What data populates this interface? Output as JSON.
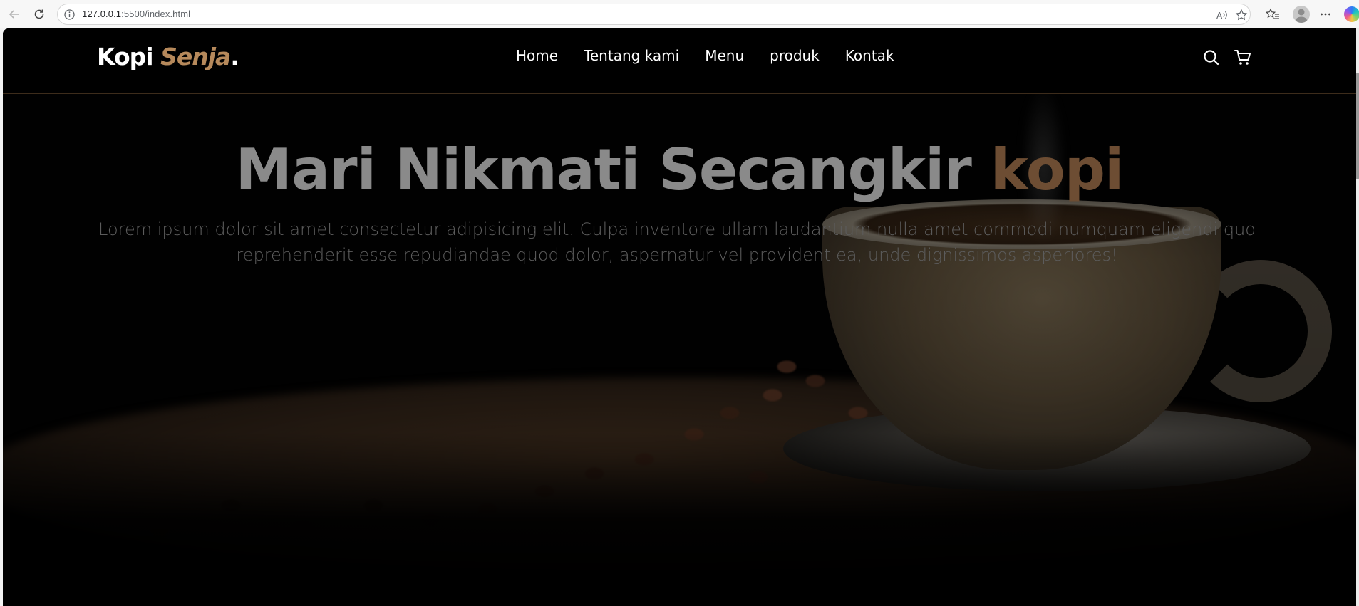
{
  "browser": {
    "url_host": "127.0.0.1",
    "url_path": ":5500/index.html",
    "icons": [
      "back-icon",
      "reload-icon",
      "info-icon",
      "read-aloud-icon",
      "favorite-star-icon",
      "favorites-list-icon",
      "profile-icon",
      "more-icon",
      "copilot-icon"
    ]
  },
  "navbar": {
    "logo_main": "Kopi ",
    "logo_accent": "Senja",
    "logo_dot": ".",
    "links": [
      "Home",
      "Tentang kami",
      "Menu",
      "produk",
      "Kontak"
    ],
    "icons": [
      "search-icon",
      "cart-icon"
    ]
  },
  "hero": {
    "title_main": "Mari Nikmati Secangkir ",
    "title_accent": "kopi",
    "description": "Lorem ipsum dolor sit amet consectetur adipisicing elit. Culpa inventore ullam laudantium nulla amet commodi numquam eligendi quo reprehenderit esse repudiandae quod dolor, aspernatur vel provident ea, unde dignissimos asperiores!"
  },
  "colors": {
    "accent": "#b6895b",
    "background": "#010101",
    "nav_text": "#ffffff"
  }
}
